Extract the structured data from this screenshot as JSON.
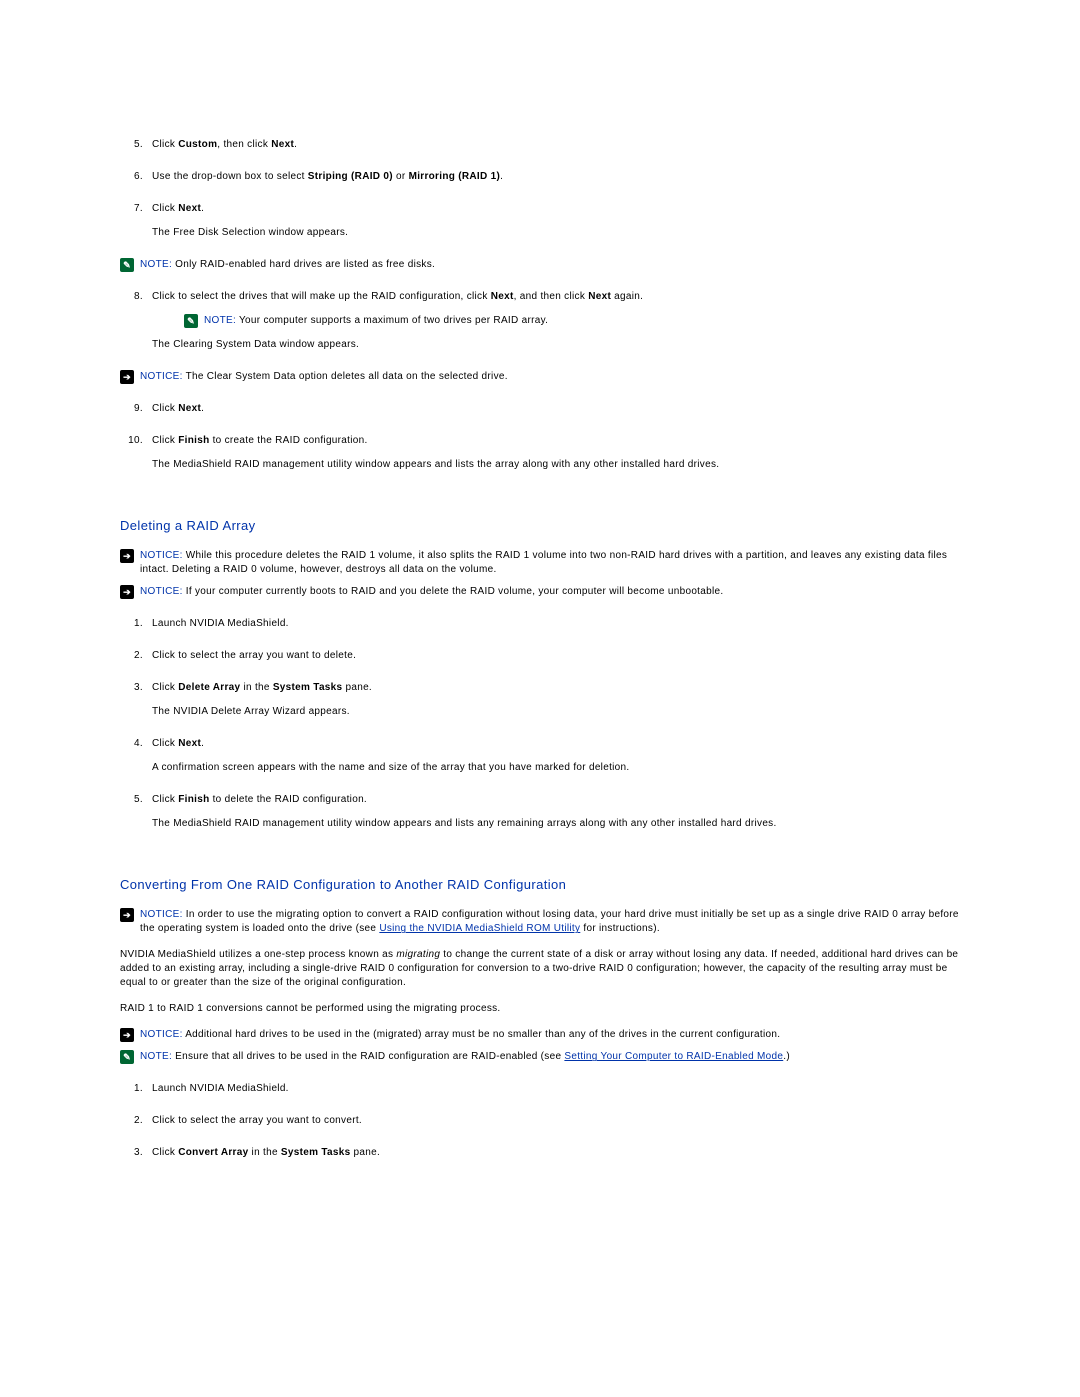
{
  "steps_top": {
    "s5": {
      "pre": "Click ",
      "b1": "Custom",
      "mid": ", then click ",
      "b2": "Next",
      "post": "."
    },
    "s6": {
      "pre": "Use the drop-down box to select ",
      "b1": "Striping (RAID 0)",
      "mid": " or ",
      "b2": "Mirroring (RAID 1)",
      "post": "."
    },
    "s7": {
      "pre": "Click ",
      "b1": "Next",
      "post": ".",
      "sub": "The Free Disk Selection window appears."
    },
    "note7": {
      "label": "NOTE:",
      "text": " Only RAID-enabled hard drives are listed as free disks."
    },
    "s8": {
      "pre": "Click to select the drives that will make up the RAID configuration, click ",
      "b1": "Next",
      "mid": ", and then click ",
      "b2": "Next",
      "post": " again.",
      "note": {
        "label": "NOTE:",
        "text": " Your computer supports a maximum of two drives per RAID array."
      },
      "sub": "The Clearing System Data window appears."
    },
    "notice8": {
      "label": "NOTICE:",
      "text": " The Clear System Data option deletes all data on the selected drive."
    },
    "s9": {
      "pre": "Click ",
      "b1": "Next",
      "post": "."
    },
    "s10": {
      "pre": "Click ",
      "b1": "Finish",
      "post": " to create the RAID configuration.",
      "sub": "The MediaShield RAID management utility window appears and lists the array along with any other installed hard drives."
    }
  },
  "deleting": {
    "heading": "Deleting a RAID Array",
    "notice1": {
      "label": "NOTICE:",
      "text": " While this procedure deletes the RAID 1 volume, it also splits the RAID 1 volume into two non-RAID hard drives with a partition, and leaves any existing data files intact. Deleting a RAID 0 volume, however, destroys all data on the volume."
    },
    "notice2": {
      "label": "NOTICE:",
      "text": " If your computer currently boots to RAID and you delete the RAID volume, your computer will become unbootable."
    },
    "s1": "Launch NVIDIA MediaShield.",
    "s2": "Click to select the array you want to delete.",
    "s3": {
      "pre": "Click ",
      "b1": "Delete Array",
      "mid": " in the ",
      "b2": "System Tasks",
      "post": " pane.",
      "sub": "The NVIDIA Delete Array Wizard appears."
    },
    "s4": {
      "pre": "Click ",
      "b1": "Next",
      "post": ".",
      "sub": "A confirmation screen appears with the name and size of the array that you have marked for deletion."
    },
    "s5": {
      "pre": "Click ",
      "b1": "Finish",
      "post": " to delete the RAID configuration.",
      "sub": "The MediaShield RAID management utility window appears and lists any remaining arrays along with any other installed hard drives."
    }
  },
  "converting": {
    "heading": "Converting From One RAID Configuration to Another RAID Configuration",
    "notice1": {
      "label": "NOTICE:",
      "text_pre": " In order to use the migrating option to convert a RAID configuration without losing data, your hard drive must initially be set up as a single drive RAID 0 array before the operating system is loaded onto the drive (see ",
      "link": "Using the NVIDIA MediaShield ROM Utility",
      "text_post": " for instructions)."
    },
    "para1_pre": "NVIDIA MediaShield utilizes a one-step process known as ",
    "para1_em": "migrating",
    "para1_post": " to change the current state of a disk or array without losing any data. If needed, additional hard drives can be added to an existing array, including a single-drive RAID 0 configuration for conversion to a two-drive RAID 0 configuration; however, the capacity of the resulting array must be equal to or greater than the size of the original configuration.",
    "para2": "RAID 1 to RAID 1 conversions cannot be performed using the migrating process.",
    "notice2": {
      "label": "NOTICE:",
      "text": " Additional hard drives to be used in the (migrated) array must be no smaller than any of the drives in the current configuration."
    },
    "note1": {
      "label": "NOTE:",
      "text_pre": " Ensure that all drives to be used in the RAID configuration are RAID-enabled (see ",
      "link": "Setting Your Computer to RAID-Enabled Mode",
      "text_post": ".)"
    },
    "s1": "Launch NVIDIA MediaShield.",
    "s2": "Click to select the array you want to convert.",
    "s3": {
      "pre": "Click ",
      "b1": "Convert Array",
      "mid": " in the ",
      "b2": "System Tasks",
      "post": " pane."
    }
  }
}
